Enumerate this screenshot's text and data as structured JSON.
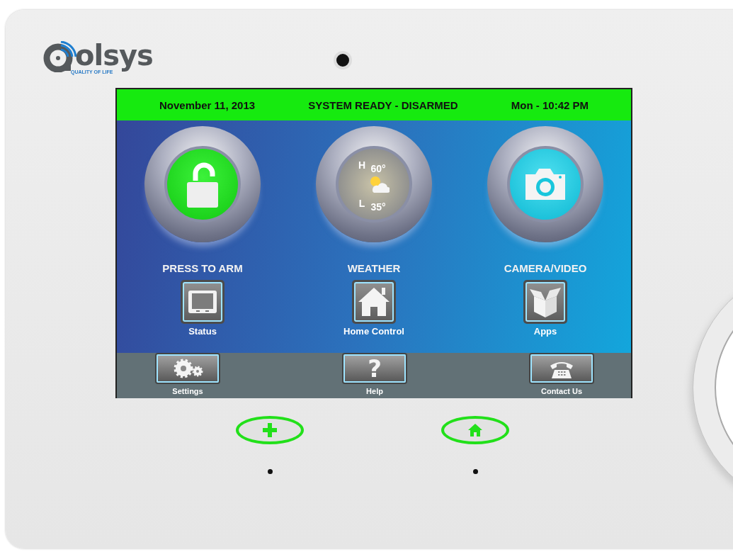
{
  "brand": {
    "name": "olsys",
    "tagline": "QUALITY OF LIFE"
  },
  "header": {
    "date": "November 11, 2013",
    "status": "SYSTEM READY - DISARMED",
    "time": "Mon - 10:42 PM"
  },
  "main_tiles": [
    {
      "kind": "lock",
      "label": "PRESS TO ARM"
    },
    {
      "kind": "weather",
      "label": "WEATHER",
      "high_label": "H",
      "high": "60°",
      "low_label": "L",
      "low": "35°"
    },
    {
      "kind": "camera",
      "label": "CAMERA/VIDEO"
    }
  ],
  "shortcuts": [
    {
      "kind": "tablet",
      "label": "Status"
    },
    {
      "kind": "house",
      "label": "Home Control"
    },
    {
      "kind": "box",
      "label": "Apps"
    }
  ],
  "bottom_bar": [
    {
      "kind": "gears",
      "label": "Settings"
    },
    {
      "kind": "question",
      "label": "Help",
      "glyph": "?"
    },
    {
      "kind": "phone",
      "label": "Contact Us"
    }
  ],
  "hardware_buttons": [
    {
      "kind": "plus"
    },
    {
      "kind": "home"
    }
  ]
}
